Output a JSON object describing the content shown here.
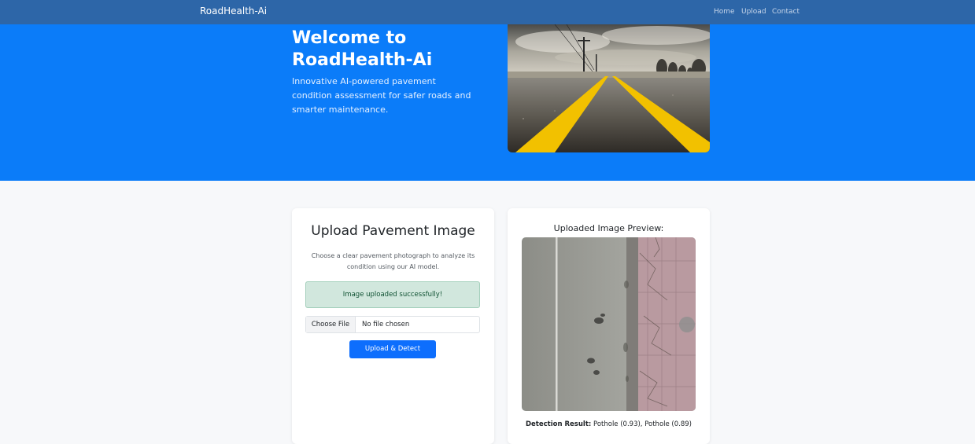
{
  "nav": {
    "brand": "RoadHealth-Ai",
    "links": [
      "Home",
      "Upload",
      "Contact"
    ]
  },
  "hero": {
    "title": "Welcome to RoadHealth-Ai",
    "subtitle": "Innovative AI-powered pavement condition assessment for safer roads and smarter maintenance.",
    "image": "road-yellow-lines-photo"
  },
  "upload": {
    "title": "Upload Pavement Image",
    "description": "Choose a clear pavement photograph to analyze its condition using our AI model.",
    "alert": "Image uploaded successfully!",
    "file_button": "Choose File",
    "file_status": "No file chosen",
    "submit": "Upload & Detect"
  },
  "preview": {
    "title": "Uploaded Image Preview:",
    "image": "pavement-aerial-photo",
    "result_label": "Detection Result:",
    "result_value": "Pothole (0.93), Pothole (0.89)"
  },
  "colors": {
    "navbar": "#2d66a8",
    "hero": "#0b7cf9",
    "primary_button": "#0d6efd",
    "alert_bg": "#d1e7dd",
    "page_bg": "#f7f8fa"
  }
}
